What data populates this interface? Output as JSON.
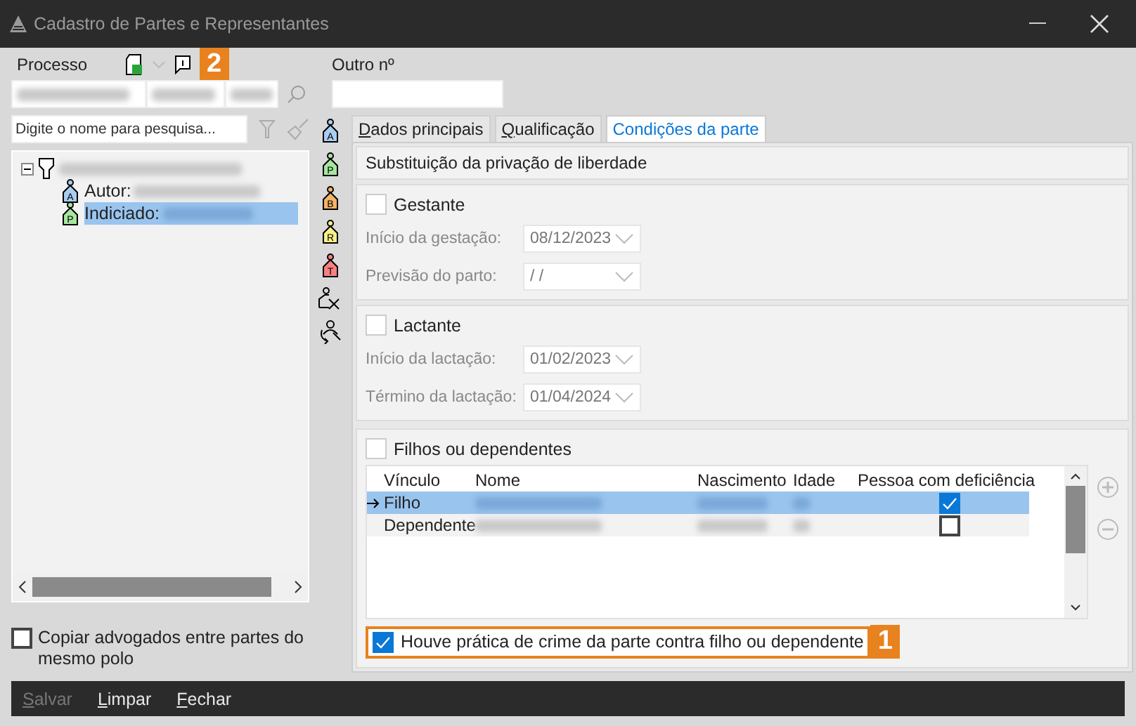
{
  "window": {
    "title": "Cadastro de Partes e Representantes"
  },
  "processo": {
    "label": "Processo",
    "callout": "2",
    "outro_label": "Outro nº"
  },
  "search": {
    "placeholder": "Digite o nome para pesquisa..."
  },
  "tree": [
    {
      "kind": "process",
      "children": [
        {
          "kind": "person",
          "label": "Autor:",
          "letter": "A",
          "color": "#a9cdf0",
          "selected": false
        },
        {
          "kind": "person",
          "label": "Indiciado:",
          "letter": "P",
          "color": "#a6e6a0",
          "selected": true
        }
      ]
    }
  ],
  "tools": [
    {
      "kind": "person",
      "letter": "A",
      "color": "#a9cdf0"
    },
    {
      "kind": "person",
      "letter": "P",
      "color": "#a6e6a0"
    },
    {
      "kind": "person",
      "letter": "B",
      "color": "#f5b368"
    },
    {
      "kind": "person",
      "letter": "R",
      "color": "#f7f08c"
    },
    {
      "kind": "person",
      "letter": "T",
      "color": "#f78080"
    },
    {
      "kind": "remove"
    },
    {
      "kind": "swap"
    }
  ],
  "tabs": [
    {
      "label": "Dados principais",
      "selected": false
    },
    {
      "label": "Qualificação",
      "selected": false
    },
    {
      "label": "Condições da parte",
      "selected": true
    }
  ],
  "section_title": "Substituição da privação de liberdade",
  "groups": [
    {
      "label": "Gestante",
      "checked": false,
      "fields": [
        {
          "label": "Início da gestação:",
          "value": "08/12/2023"
        },
        {
          "label": "Previsão do parto:",
          "value": "/ /"
        }
      ]
    },
    {
      "label": "Lactante",
      "checked": false,
      "fields": [
        {
          "label": "Início da lactação:",
          "value": "01/02/2023"
        },
        {
          "label": "Término da lactação:",
          "value": "01/04/2024"
        }
      ]
    }
  ],
  "filhos": {
    "label": "Filhos ou dependentes",
    "checked": false,
    "columns": [
      "Vínculo",
      "Nome",
      "Nascimento",
      "Idade",
      "Pessoa com deficiência"
    ],
    "rows": [
      {
        "vinculo": "Filho",
        "selected": true,
        "deficiencia": true
      },
      {
        "vinculo": "Dependente",
        "selected": false,
        "deficiencia": false
      }
    ]
  },
  "crime": {
    "label": "Houve prática de crime da parte contra filho ou dependente",
    "checked": true,
    "callout": "1"
  },
  "copiar": {
    "label": "Copiar advogados entre partes do mesmo polo",
    "checked": false
  },
  "buttons": [
    {
      "label": "Salvar",
      "disabled": true
    },
    {
      "label": "Limpar",
      "disabled": false
    },
    {
      "label": "Fechar",
      "disabled": false
    }
  ]
}
